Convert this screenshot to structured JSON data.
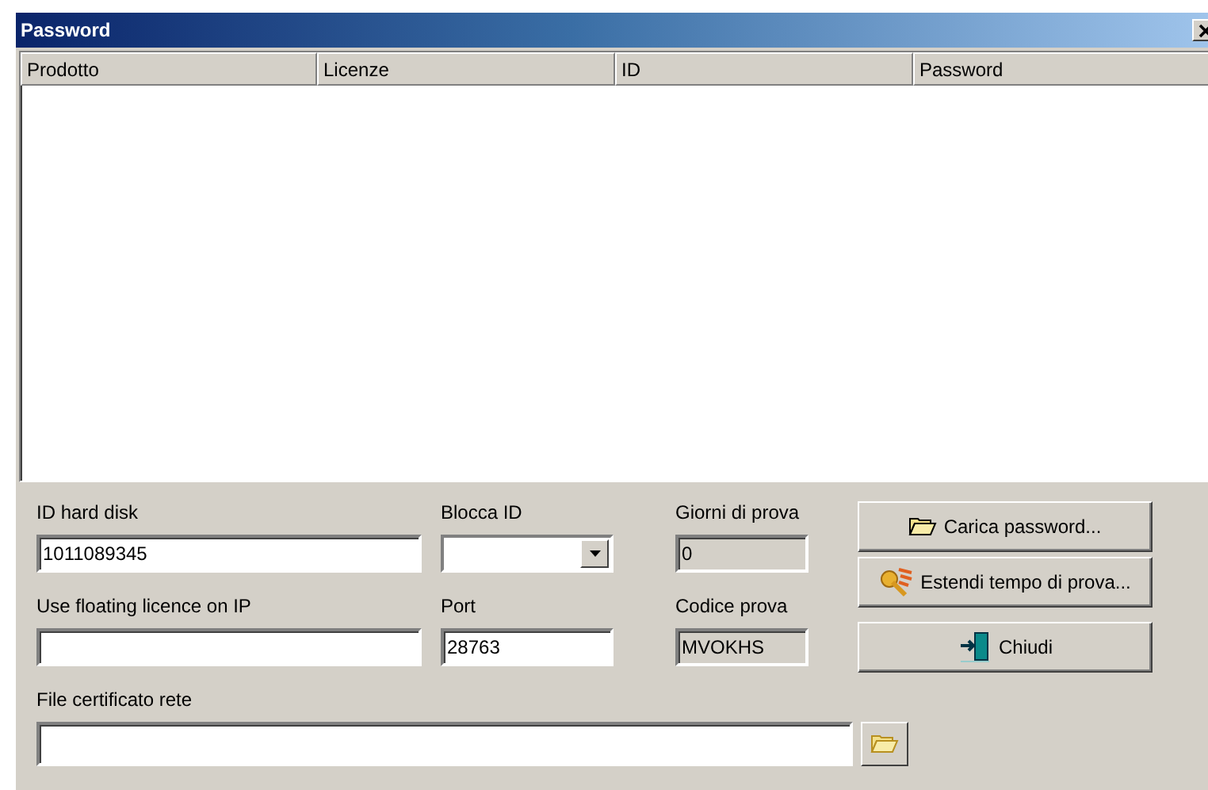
{
  "window": {
    "title": "Password"
  },
  "table": {
    "columns": [
      "Prodotto",
      "Licenze",
      "ID",
      "Password"
    ]
  },
  "fields": [
    {
      "kind": "text",
      "label": "ID hard disk",
      "value": "1011089345"
    },
    {
      "kind": "combo",
      "label": "Blocca ID"
    },
    {
      "kind": "readonly",
      "label": "Giorni di prova",
      "value": "0"
    },
    {
      "kind": "text",
      "label": "Use floating licence on IP"
    },
    {
      "kind": "text",
      "label": "Port",
      "value": "28763"
    },
    {
      "kind": "readonly",
      "label": "Codice prova",
      "value": "MVOKHS"
    },
    {
      "kind": "file",
      "label": "File certificato rete"
    }
  ],
  "buttons": [
    {
      "kind": "load",
      "label": "Carica password..."
    },
    {
      "kind": "extend",
      "label": "Estendi tempo di prova..."
    },
    {
      "kind": "close",
      "label": "Chiudi"
    }
  ]
}
